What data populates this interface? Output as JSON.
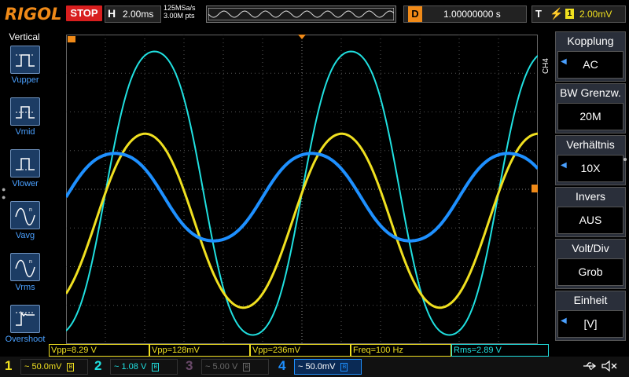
{
  "top": {
    "logo": "RIGOL",
    "run_state": "STOP",
    "timebase_label": "H",
    "timebase_value": "2.00ms",
    "sample_rate": "125MSa/s",
    "memory_depth": "3.00M pts",
    "delay_label": "D",
    "delay_value": "1.00000000 s",
    "trigger_label": "T",
    "trigger_edge": "rising-edge-icon",
    "trigger_source": "1",
    "trigger_level": "2.00mV"
  },
  "left_menu": {
    "title": "Vertical",
    "items": [
      {
        "label": "Vupper",
        "icon": "vupper-icon"
      },
      {
        "label": "Vmid",
        "icon": "vmid-icon"
      },
      {
        "label": "Vlower",
        "icon": "vlower-icon"
      },
      {
        "label": "Vavg",
        "icon": "vavg-icon"
      },
      {
        "label": "Vrms",
        "icon": "vrms-icon"
      },
      {
        "label": "Overshoot",
        "icon": "overshoot-icon"
      }
    ]
  },
  "markers": {
    "ch4_level": "4",
    "trigger_pos": "T"
  },
  "right_menu": {
    "channel_tag": "CH4",
    "items": [
      {
        "label": "Kopplung",
        "value": "AC"
      },
      {
        "label": "BW Grenzw.",
        "value": "20M"
      },
      {
        "label": "Verhältnis",
        "value": "10X"
      },
      {
        "label": "Invers",
        "value": "AUS"
      },
      {
        "label": "Volt/Div",
        "value": "Grob"
      },
      {
        "label": "Einheit",
        "value": "[V]"
      }
    ]
  },
  "measurements": [
    {
      "text": "Vpp=8.29 V",
      "color": "yellow"
    },
    {
      "text": "Vpp=128mV",
      "color": "yellow"
    },
    {
      "text": "Vpp=236mV",
      "color": "yellow"
    },
    {
      "text": "Freq=100 Hz",
      "color": "yellow"
    },
    {
      "text": "Rms=2.89 V",
      "color": "cyan"
    }
  ],
  "channels": [
    {
      "num": "1",
      "value": "50.0mV",
      "color": "#f0e020"
    },
    {
      "num": "2",
      "value": "1.08 V",
      "color": "#20e0e0"
    },
    {
      "num": "3",
      "value": "5.00 V",
      "color": "#c060c0"
    },
    {
      "num": "4",
      "value": "50.0mV",
      "color": "#1e90ff"
    }
  ],
  "coupling_symbol": "~",
  "colors": {
    "ch1": "#f0e020",
    "ch2": "#20e0e0",
    "ch3": "#c060c0",
    "ch4": "#1e90ff",
    "accent": "#f08a18",
    "stop": "#d81e1e"
  }
}
